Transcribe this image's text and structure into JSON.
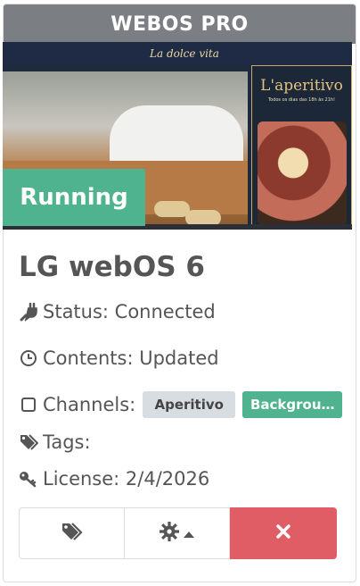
{
  "card": {
    "header": "WEBOS PRO",
    "status_badge": "Running",
    "device_name": "LG webOS 6",
    "status_line": "Status: Connected",
    "contents_line": "Contents: Updated",
    "channels_label": "Channels:",
    "channels": [
      "Aperitivo",
      "Backgrou…"
    ],
    "tags_label": "Tags:",
    "license_line": "License: 2/4/2026"
  },
  "preview": {
    "banner_text": "La dolce vita",
    "poster_title": "L'aperitivo",
    "poster_subtitle": "Todos os dias das 18h às 21h!"
  },
  "colors": {
    "header_bg": "#7b7f84",
    "running_green": "#4fb38f",
    "delete_red": "#e05d66",
    "chip_gray": "#d8dde1"
  },
  "icons": {
    "status": "plug-icon",
    "contents": "clock-icon",
    "channels": "checkbox-icon",
    "tags": "tags-icon",
    "license": "key-icon",
    "tags_button": "tags-icon",
    "settings_button": "gear-icon",
    "delete_button": "close-icon"
  }
}
